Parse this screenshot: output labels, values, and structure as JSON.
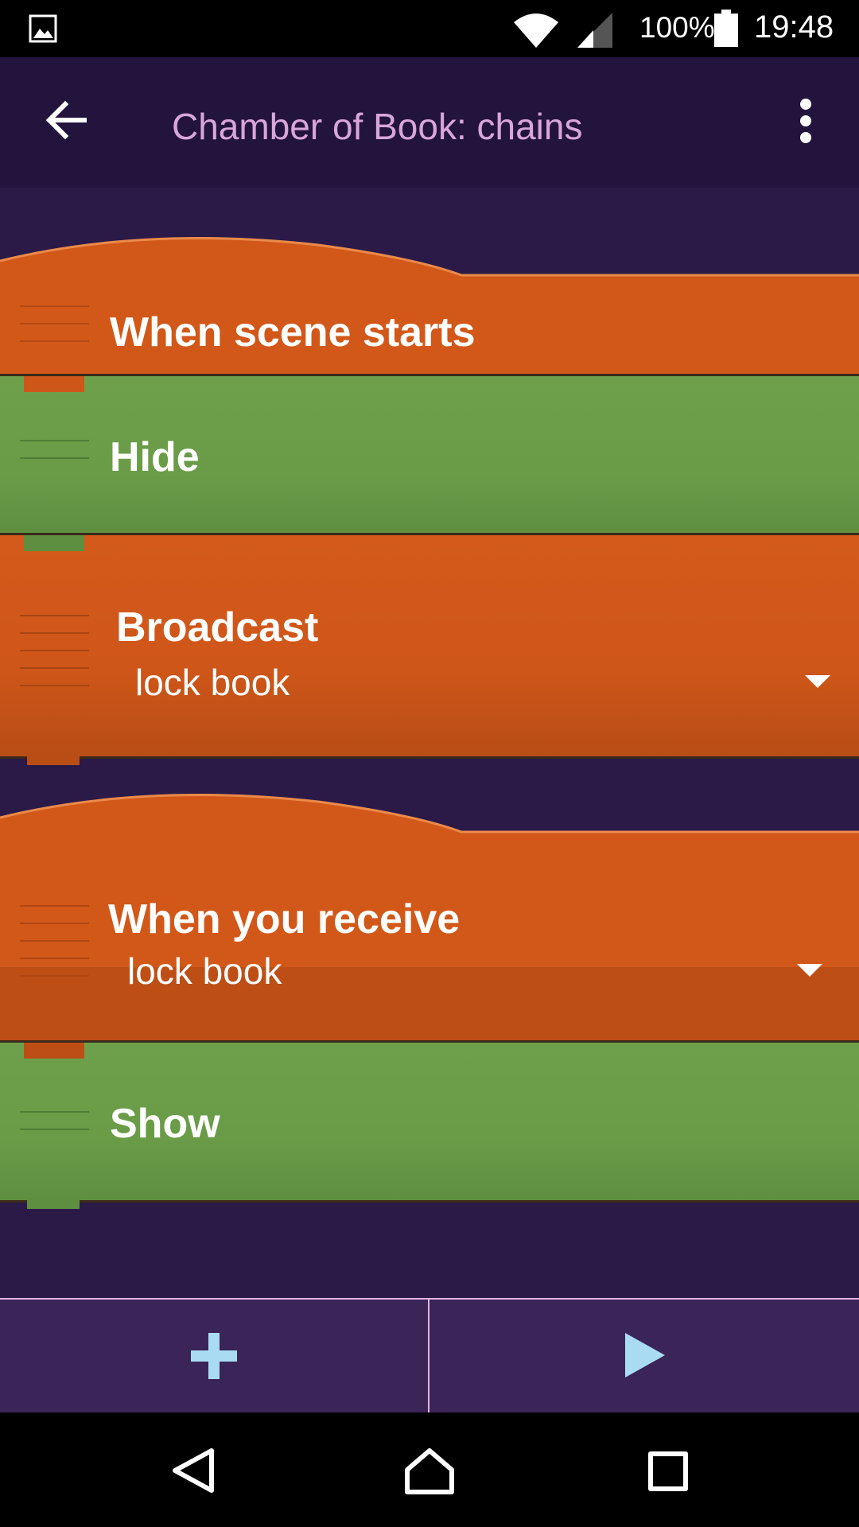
{
  "status_bar": {
    "battery": "100%",
    "time": "19:48",
    "icons": [
      "image-icon",
      "wifi-icon",
      "cell-signal-icon",
      "battery-icon"
    ]
  },
  "toolbar": {
    "title": "Chamber of Book: chains",
    "back_icon": "arrow-left-icon",
    "menu_icon": "more-vertical-icon"
  },
  "script": {
    "groups": [
      {
        "hat": {
          "label": "When scene starts"
        },
        "bricks": [
          {
            "label": "Hide"
          },
          {
            "label": "Broadcast",
            "value": "lock book"
          }
        ]
      },
      {
        "hat": {
          "label": "When you receive",
          "value": "lock book"
        },
        "bricks": [
          {
            "label": "Show"
          }
        ]
      }
    ]
  },
  "bottom_bar": {
    "add_icon": "plus-icon",
    "play_icon": "play-icon"
  },
  "nav_bar": {
    "icons": [
      "back-triangle-icon",
      "home-icon",
      "recents-icon"
    ]
  },
  "colors": {
    "background": "#2b1a47",
    "toolbar": "#23143e",
    "title_text": "#d8a6d8",
    "event_brick": "#cf5619",
    "look_brick": "#6a9c48",
    "bottom_bar": "#3a2458",
    "action_icon": "#a9dcf3"
  }
}
